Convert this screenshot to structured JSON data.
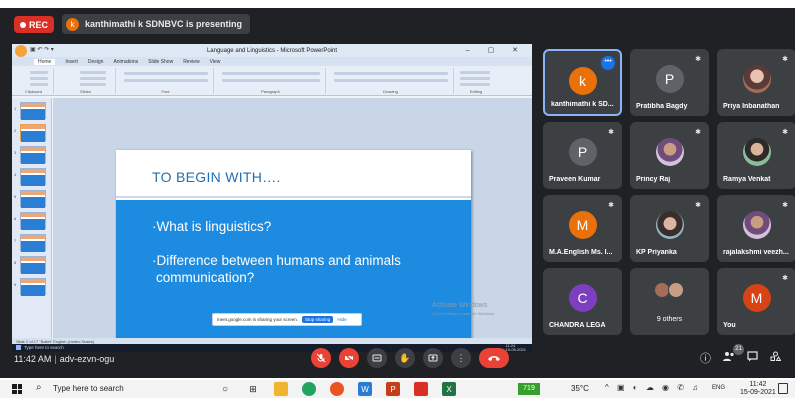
{
  "meet": {
    "rec_label": "REC",
    "presenter_initial": "k",
    "presenter_text": "kanthimathi k SDNBVC is presenting",
    "meeting_time": "11:42 AM",
    "meeting_code": "adv-ezvn-ogu",
    "participant_count": "21"
  },
  "ppt": {
    "window_title": "Language and Linguistics - Microsoft PowerPoint",
    "ribbon_tabs": [
      "Home",
      "Insert",
      "Design",
      "Animations",
      "Slide Show",
      "Review",
      "View"
    ],
    "ribbon_groups": [
      "Clipboard",
      "Slides",
      "Font",
      "Paragraph",
      "Drawing",
      "Editing"
    ],
    "slide_numbers": [
      "1",
      "2",
      "3",
      "4",
      "5",
      "6",
      "7",
      "8",
      "9"
    ],
    "slide_title": "TO BEGIN WITH….",
    "bullet1": "·What is linguistics?",
    "bullet2_line1": "·Difference between humans and animals",
    "bullet2_line2": "communication?",
    "share_text": "meet.google.com is sharing your screen.",
    "stop_sharing": "Stop sharing",
    "hide": "Hide",
    "watermark1": "Activate Windows",
    "watermark2": "Go to Settings to activate Windows.",
    "status": "Slide 2 of 17    \"Ballet\"    English (United States)",
    "inner_search": "Type here to search",
    "inner_time": "11:24",
    "inner_date": "15-09-2021"
  },
  "tiles": [
    {
      "name": "kanthimathi k SD...",
      "initial": "k",
      "color": "#e8710a",
      "type": "letter",
      "active": true,
      "menu": "•••"
    },
    {
      "name": "Pratibha Bagdy",
      "initial": "P",
      "color": "#5f6368",
      "type": "letter",
      "muted": true
    },
    {
      "name": "Priya Inbanathan",
      "type": "photo",
      "muted": true
    },
    {
      "name": "Praveen Kumar",
      "initial": "P",
      "color": "#5f6368",
      "type": "letter",
      "muted": true
    },
    {
      "name": "Princy Raj",
      "type": "photo",
      "muted": true
    },
    {
      "name": "Ramya Venkat",
      "type": "photo",
      "muted": true
    },
    {
      "name": "M.A.English Ms. I...",
      "initial": "M",
      "color": "#e8710a",
      "type": "letter",
      "muted": true
    },
    {
      "name": "KP Priyanka",
      "type": "photo",
      "muted": true
    },
    {
      "name": "rajalakshmi veezh...",
      "type": "photo",
      "muted": true
    },
    {
      "name": "CHANDRA LEGA",
      "initial": "C",
      "color": "#7b3fbf",
      "type": "letter"
    },
    {
      "name": "9 others",
      "type": "others"
    },
    {
      "name": "You",
      "initial": "M",
      "color": "#d84315",
      "type": "letter",
      "muted": true
    }
  ],
  "icons": {
    "mute": "✱",
    "mic_off": "mic-off-icon",
    "cam_off": "camera-off-icon",
    "captions": "captions-icon",
    "raise_hand": "hand-icon",
    "present": "present-icon",
    "more": "more-icon",
    "hangup": "hangup-icon",
    "info": "info-icon",
    "people": "people-icon",
    "chat": "chat-icon",
    "activities": "activities-icon"
  },
  "taskbar": {
    "search_text": "Type here to search",
    "weather_badge": "719",
    "temperature": "35°C",
    "lang": "ENG",
    "time": "11:42",
    "date": "15-09-2021"
  },
  "colors": {
    "meet_bg": "#202124",
    "tile_bg": "#3c4043",
    "red": "#ea4335",
    "slide_blue": "#1c8be0",
    "title_blue": "#1f6fb2"
  }
}
